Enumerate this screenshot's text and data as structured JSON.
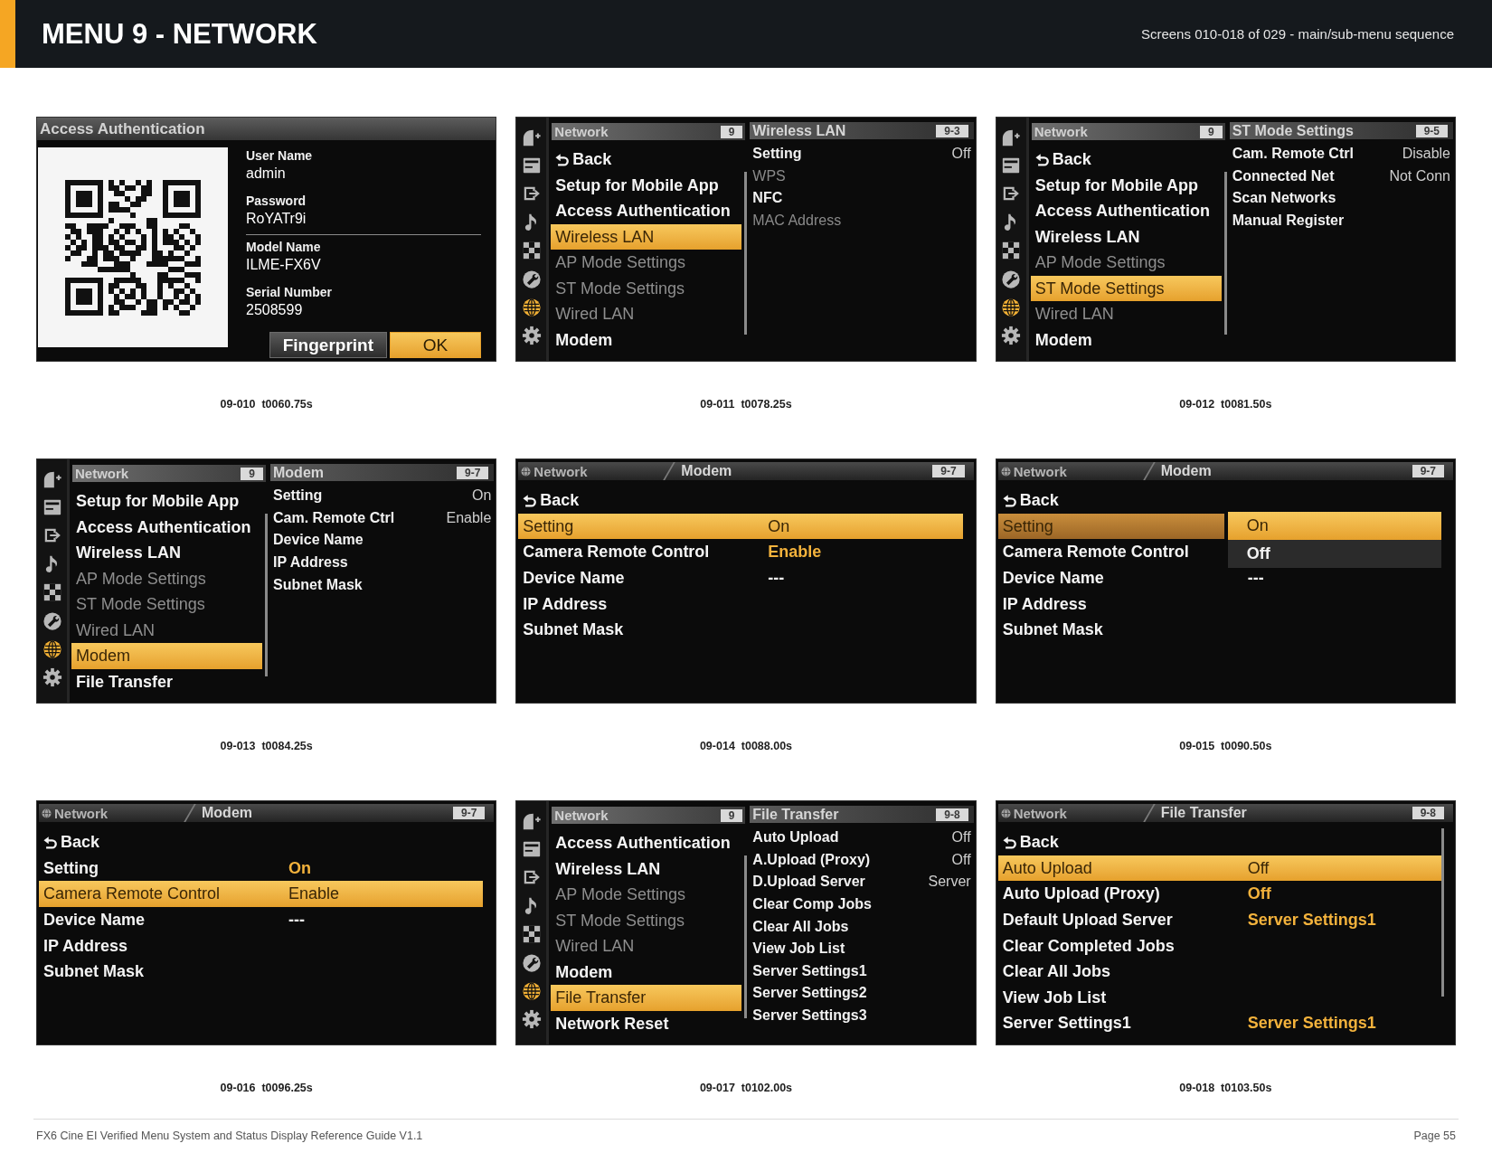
{
  "header": {
    "title": "MENU 9 - NETWORK",
    "subtitle": "Screens 010-018 of 029 - main/sub-menu sequence"
  },
  "screens": [
    {
      "kind": "auth",
      "title": "Access Authentication",
      "sections": [
        {
          "fields": [
            {
              "label": "User Name",
              "value": "admin"
            },
            {
              "label": "Password",
              "value": "RoYATr9i"
            }
          ]
        },
        {
          "fields": [
            {
              "label": "Model Name",
              "value": "ILME-FX6V"
            },
            {
              "label": "Serial Number",
              "value": "2508599"
            }
          ]
        }
      ],
      "buttons": [
        {
          "label": "Fingerprint",
          "selected": false
        },
        {
          "label": "OK",
          "selected": true
        }
      ],
      "caption": "09-010  t0060.75s"
    },
    {
      "kind": "split",
      "categories": [
        {
          "selected": false
        },
        {
          "selected": false
        },
        {
          "selected": false
        },
        {
          "selected": false
        },
        {
          "selected": false
        },
        {
          "selected": false
        },
        {
          "selected": true
        },
        {
          "selected": false
        }
      ],
      "menu": {
        "title": "Network",
        "badge": "9",
        "items": [
          {
            "kind": "back",
            "label": "Back",
            "selected": false,
            "disabled": false
          },
          {
            "kind": "item",
            "label": "Setup for Mobile App",
            "selected": false,
            "disabled": false
          },
          {
            "kind": "item",
            "label": "Access Authentication",
            "selected": false,
            "disabled": false
          },
          {
            "kind": "item",
            "label": "Wireless LAN",
            "selected": true,
            "disabled": false
          },
          {
            "kind": "item",
            "label": "AP Mode Settings",
            "selected": false,
            "disabled": true
          },
          {
            "kind": "item",
            "label": "ST Mode Settings",
            "selected": false,
            "disabled": true
          },
          {
            "kind": "item",
            "label": "Wired LAN",
            "selected": false,
            "disabled": true
          },
          {
            "kind": "item",
            "label": "Modem",
            "selected": false,
            "disabled": false
          }
        ]
      },
      "submenu": {
        "title": "Wireless LAN",
        "badge": "9-3",
        "items": [
          {
            "label": "Setting",
            "value": "Off",
            "disabled": false
          },
          {
            "label": "WPS",
            "disabled": true
          },
          {
            "label": "NFC",
            "disabled": false
          },
          {
            "label": "MAC Address",
            "disabled": true
          }
        ]
      },
      "caption": "09-011  t0078.25s"
    },
    {
      "kind": "split",
      "categories": [
        {
          "selected": false
        },
        {
          "selected": false
        },
        {
          "selected": false
        },
        {
          "selected": false
        },
        {
          "selected": false
        },
        {
          "selected": false
        },
        {
          "selected": true
        },
        {
          "selected": false
        }
      ],
      "menu": {
        "title": "Network",
        "badge": "9",
        "items": [
          {
            "kind": "back",
            "label": "Back",
            "selected": false,
            "disabled": false
          },
          {
            "kind": "item",
            "label": "Setup for Mobile App",
            "selected": false,
            "disabled": false
          },
          {
            "kind": "item",
            "label": "Access Authentication",
            "selected": false,
            "disabled": false
          },
          {
            "kind": "item",
            "label": "Wireless LAN",
            "selected": false,
            "disabled": false
          },
          {
            "kind": "item",
            "label": "AP Mode Settings",
            "selected": false,
            "disabled": true
          },
          {
            "kind": "item",
            "label": "ST Mode Settings",
            "selected": true,
            "disabled": false
          },
          {
            "kind": "item",
            "label": "Wired LAN",
            "selected": false,
            "disabled": true
          },
          {
            "kind": "item",
            "label": "Modem",
            "selected": false,
            "disabled": false
          }
        ]
      },
      "submenu": {
        "title": "ST Mode Settings",
        "badge": "9-5",
        "items": [
          {
            "label": "Cam. Remote Ctrl",
            "value": "Disable",
            "disabled": false
          },
          {
            "label": "Connected Net",
            "value": "Not Conn",
            "disabled": false
          },
          {
            "label": "Scan Networks",
            "disabled": false
          },
          {
            "label": "Manual Register",
            "disabled": false
          }
        ]
      },
      "caption": "09-012  t0081.50s"
    },
    {
      "kind": "split",
      "categories": [
        {
          "selected": false
        },
        {
          "selected": false
        },
        {
          "selected": false
        },
        {
          "selected": false
        },
        {
          "selected": false
        },
        {
          "selected": false
        },
        {
          "selected": true
        },
        {
          "selected": false
        }
      ],
      "menu": {
        "title": "Network",
        "badge": "9",
        "items": [
          {
            "kind": "item",
            "label": "Setup for Mobile App",
            "selected": false,
            "disabled": false
          },
          {
            "kind": "item",
            "label": "Access Authentication",
            "selected": false,
            "disabled": false
          },
          {
            "kind": "item",
            "label": "Wireless LAN",
            "selected": false,
            "disabled": false
          },
          {
            "kind": "item",
            "label": "AP Mode Settings",
            "selected": false,
            "disabled": true
          },
          {
            "kind": "item",
            "label": "ST Mode Settings",
            "selected": false,
            "disabled": true
          },
          {
            "kind": "item",
            "label": "Wired LAN",
            "selected": false,
            "disabled": true
          },
          {
            "kind": "item",
            "label": "Modem",
            "selected": true,
            "disabled": false
          },
          {
            "kind": "item",
            "label": "File Transfer",
            "selected": false,
            "disabled": false
          }
        ]
      },
      "submenu": {
        "title": "Modem",
        "badge": "9-7",
        "items": [
          {
            "label": "Setting",
            "value": "On",
            "disabled": false
          },
          {
            "label": "Cam. Remote Ctrl",
            "value": "Enable",
            "disabled": false
          },
          {
            "label": "Device Name",
            "disabled": false
          },
          {
            "label": "IP Address",
            "disabled": false
          },
          {
            "label": "Subnet Mask",
            "disabled": false
          }
        ]
      },
      "caption": "09-013  t0084.25s"
    },
    {
      "kind": "full",
      "section": "Network",
      "title": "Modem",
      "badge": "9-7",
      "items": [
        {
          "kind": "back",
          "label": "Back",
          "selected": false
        },
        {
          "kind": "item",
          "label": "Setting",
          "value": "On",
          "value_accent": true,
          "selected": true
        },
        {
          "kind": "item",
          "label": "Camera Remote Control",
          "value": "Enable",
          "value_accent": true,
          "selected": false
        },
        {
          "kind": "item",
          "label": "Device Name",
          "value": "---",
          "value_accent": false,
          "selected": false
        },
        {
          "kind": "item",
          "label": "IP Address",
          "selected": false
        },
        {
          "kind": "item",
          "label": "Subnet Mask",
          "selected": false
        }
      ],
      "caption": "09-014  t0088.00s"
    },
    {
      "kind": "full",
      "section": "Network",
      "title": "Modem",
      "badge": "9-7",
      "items": [
        {
          "kind": "back",
          "label": "Back",
          "selected": false
        },
        {
          "kind": "item",
          "label": "Setting",
          "selected": true
        },
        {
          "kind": "item",
          "label": "Camera Remote Control",
          "selected": false
        },
        {
          "kind": "item",
          "label": "Device Name",
          "value": "---",
          "value_accent": false,
          "selected": false
        },
        {
          "kind": "item",
          "label": "IP Address",
          "selected": false
        },
        {
          "kind": "item",
          "label": "Subnet Mask",
          "selected": false
        }
      ],
      "dropdown": {
        "options": [
          {
            "label": "On",
            "selected": true
          },
          {
            "label": "Off",
            "selected": false
          }
        ]
      },
      "caption": "09-015  t0090.50s"
    },
    {
      "kind": "full",
      "section": "Network",
      "title": "Modem",
      "badge": "9-7",
      "items": [
        {
          "kind": "back",
          "label": "Back",
          "selected": false
        },
        {
          "kind": "item",
          "label": "Setting",
          "value": "On",
          "value_accent": true,
          "selected": false
        },
        {
          "kind": "item",
          "label": "Camera Remote Control",
          "value": "Enable",
          "value_accent": true,
          "selected": true
        },
        {
          "kind": "item",
          "label": "Device Name",
          "value": "---",
          "value_accent": false,
          "selected": false
        },
        {
          "kind": "item",
          "label": "IP Address",
          "selected": false
        },
        {
          "kind": "item",
          "label": "Subnet Mask",
          "selected": false
        }
      ],
      "caption": "09-016  t0096.25s"
    },
    {
      "kind": "split",
      "categories": [
        {
          "selected": false
        },
        {
          "selected": false
        },
        {
          "selected": false
        },
        {
          "selected": false
        },
        {
          "selected": false
        },
        {
          "selected": false
        },
        {
          "selected": true
        },
        {
          "selected": false
        }
      ],
      "menu": {
        "title": "Network",
        "badge": "9",
        "items": [
          {
            "kind": "item",
            "label": "Access Authentication",
            "selected": false,
            "disabled": false
          },
          {
            "kind": "item",
            "label": "Wireless LAN",
            "selected": false,
            "disabled": false
          },
          {
            "kind": "item",
            "label": "AP Mode Settings",
            "selected": false,
            "disabled": true
          },
          {
            "kind": "item",
            "label": "ST Mode Settings",
            "selected": false,
            "disabled": true
          },
          {
            "kind": "item",
            "label": "Wired LAN",
            "selected": false,
            "disabled": true
          },
          {
            "kind": "item",
            "label": "Modem",
            "selected": false,
            "disabled": false
          },
          {
            "kind": "item",
            "label": "File Transfer",
            "selected": true,
            "disabled": false
          },
          {
            "kind": "item",
            "label": "Network Reset",
            "selected": false,
            "disabled": false
          }
        ]
      },
      "submenu": {
        "title": "File Transfer",
        "badge": "9-8",
        "items": [
          {
            "label": "Auto Upload",
            "value": "Off",
            "disabled": false
          },
          {
            "label": "A.Upload (Proxy)",
            "value": "Off",
            "disabled": false
          },
          {
            "label": "D.Upload Server",
            "value": "Server",
            "disabled": false
          },
          {
            "label": "Clear Comp Jobs",
            "disabled": false
          },
          {
            "label": "Clear All Jobs",
            "disabled": false
          },
          {
            "label": "View Job List",
            "disabled": false
          },
          {
            "label": "Server Settings1",
            "disabled": false
          },
          {
            "label": "Server Settings2",
            "disabled": false
          },
          {
            "label": "Server Settings3",
            "disabled": false
          }
        ]
      },
      "caption": "09-017  t0102.00s"
    },
    {
      "kind": "full",
      "section": "Network",
      "title": "File Transfer",
      "badge": "9-8",
      "scrollable": true,
      "items": [
        {
          "kind": "back",
          "label": "Back",
          "selected": false
        },
        {
          "kind": "item",
          "label": "Auto Upload",
          "value": "Off",
          "value_accent": true,
          "selected": true
        },
        {
          "kind": "item",
          "label": "Auto Upload (Proxy)",
          "value": "Off",
          "value_accent": true,
          "selected": false
        },
        {
          "kind": "item",
          "label": "Default Upload Server",
          "value": "Server Settings1",
          "value_accent": true,
          "selected": false
        },
        {
          "kind": "item",
          "label": "Clear Completed Jobs",
          "selected": false
        },
        {
          "kind": "item",
          "label": "Clear All Jobs",
          "selected": false
        },
        {
          "kind": "item",
          "label": "View Job List",
          "selected": false
        },
        {
          "kind": "item",
          "label": "Server Settings1",
          "value": "Server Settings1",
          "value_accent": true,
          "selected": false
        }
      ],
      "caption": "09-018  t0103.50s"
    }
  ],
  "footer": {
    "text": "FX6 Cine EI Verified Menu System and Status Display Reference Guide V1.1",
    "page": "Page 55"
  }
}
